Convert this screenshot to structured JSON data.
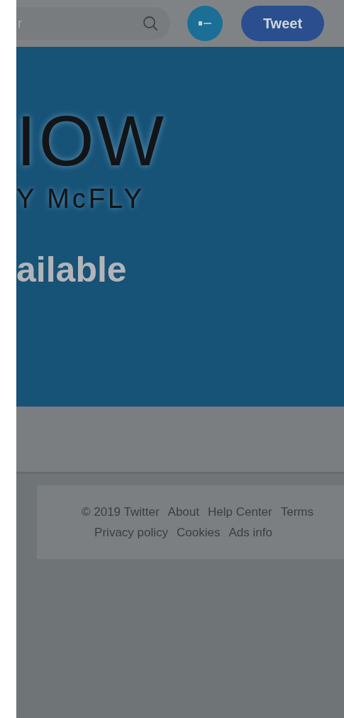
{
  "header": {
    "search": {
      "placeholder": "r"
    },
    "tweet_button": "Tweet"
  },
  "banner": {
    "headline": "IOW",
    "subtitle": "Y McFLY",
    "tagline": "ailable"
  },
  "footer": {
    "line_1": [
      "© 2019 Twitter",
      "About",
      "Help Center",
      "Terms"
    ],
    "line_2": [
      "Privacy policy",
      "Cookies",
      "Ads info"
    ]
  }
}
